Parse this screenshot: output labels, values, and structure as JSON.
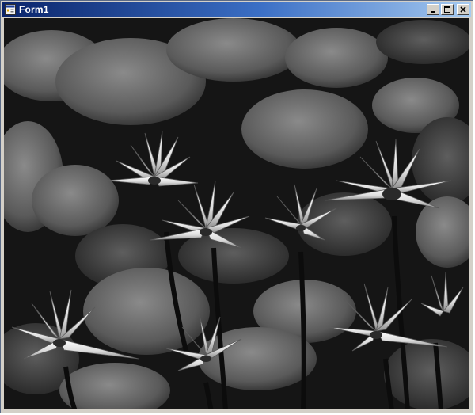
{
  "window": {
    "title": "Form1",
    "icon": "form-app-icon",
    "buttons": [
      {
        "name": "minimize-button",
        "icon": "minimize-icon"
      },
      {
        "name": "maximize-button",
        "icon": "maximize-icon"
      },
      {
        "name": "close-button",
        "icon": "close-icon"
      }
    ]
  },
  "content": {
    "image_kind": "grayscale photograph",
    "colors": {
      "title_gradient_start": "#0a246a",
      "title_gradient_end": "#a6caf0",
      "frame": "#d4d0c8"
    }
  }
}
